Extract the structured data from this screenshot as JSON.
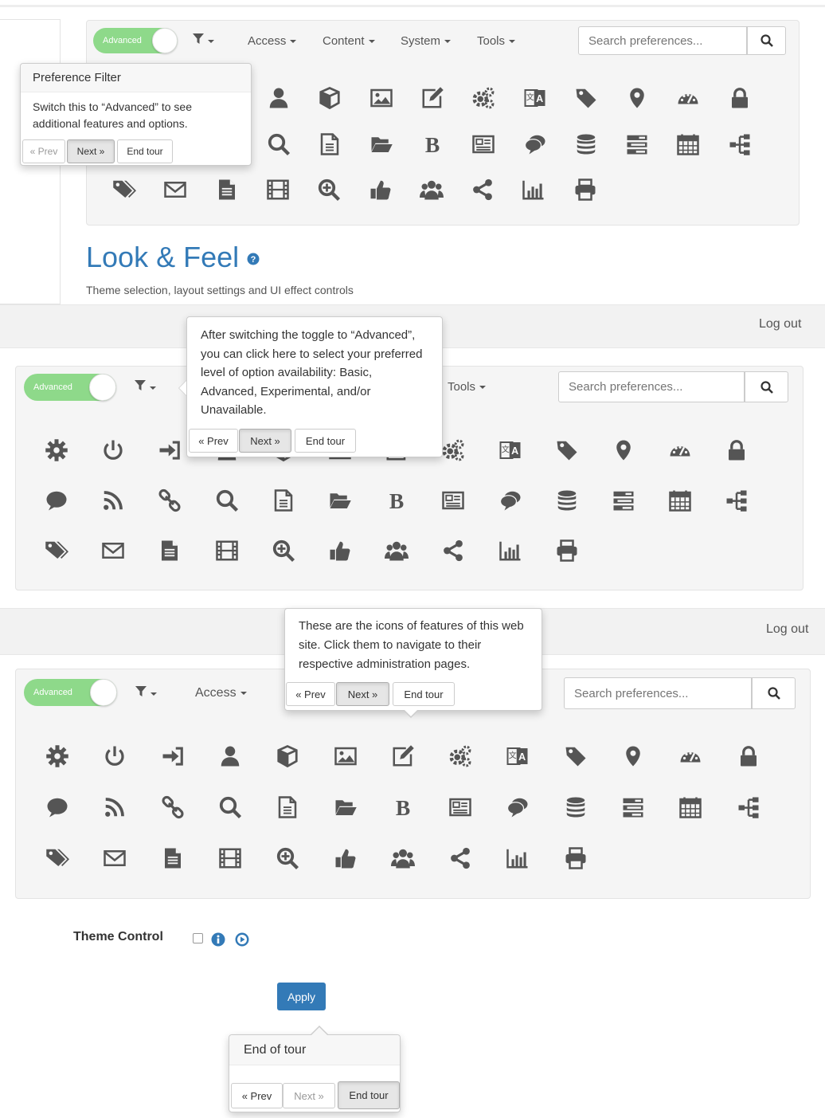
{
  "toggle_label": "Advanced",
  "nav": {
    "access": "Access",
    "content": "Content",
    "system": "System",
    "tools": "Tools"
  },
  "search": {
    "placeholder": "Search preferences..."
  },
  "logout": "Log out",
  "tour1": {
    "title": "Preference Filter",
    "body": "Switch this to “Advanced” to see additional features and options.",
    "prev": "« Prev",
    "next": "Next »",
    "end": "End tour"
  },
  "tour2": {
    "body": "After switching the toggle to “Advanced”, you can click here to select your preferred level of option availability: Basic, Advanced, Experimental, and/or Unavailable.",
    "prev": "« Prev",
    "next": "Next »",
    "end": "End tour"
  },
  "tour3": {
    "body": "These are the icons of features of this web site. Click them to navigate to their respective administration pages.",
    "prev": "« Prev",
    "next": "Next »",
    "end": "End tour"
  },
  "tour4": {
    "title": "End of tour",
    "prev": "« Prev",
    "next": "Next »",
    "end": "End tour"
  },
  "section": {
    "title": "Look & Feel",
    "subtitle": "Theme selection, layout settings and UI effect controls"
  },
  "theme_control": {
    "label": "Theme Control"
  },
  "apply": "Apply",
  "icons": [
    "gear-icon",
    "power-icon",
    "sign-in-icon",
    "user-icon",
    "cube-icon",
    "image-icon",
    "edit-icon",
    "gears-icon",
    "language-icon",
    "tag-icon",
    "map-marker-icon",
    "dashboard-icon",
    "lock-icon",
    "comment-icon",
    "rss-icon",
    "link-icon",
    "search-icon",
    "file-icon",
    "folder-open-icon",
    "bold-icon",
    "newspaper-icon",
    "comments-icon",
    "database-icon",
    "tasks-icon",
    "calendar-icon",
    "sitemap-icon",
    "tags-icon",
    "envelope-icon",
    "file-text-icon",
    "film-icon",
    "zoom-in-icon",
    "thumbs-up-icon",
    "users-icon",
    "share-icon",
    "bar-chart-icon",
    "print-icon"
  ],
  "colors": {
    "accent": "#337ab7",
    "toggle": "#8ed98a",
    "icon": "#555555"
  }
}
